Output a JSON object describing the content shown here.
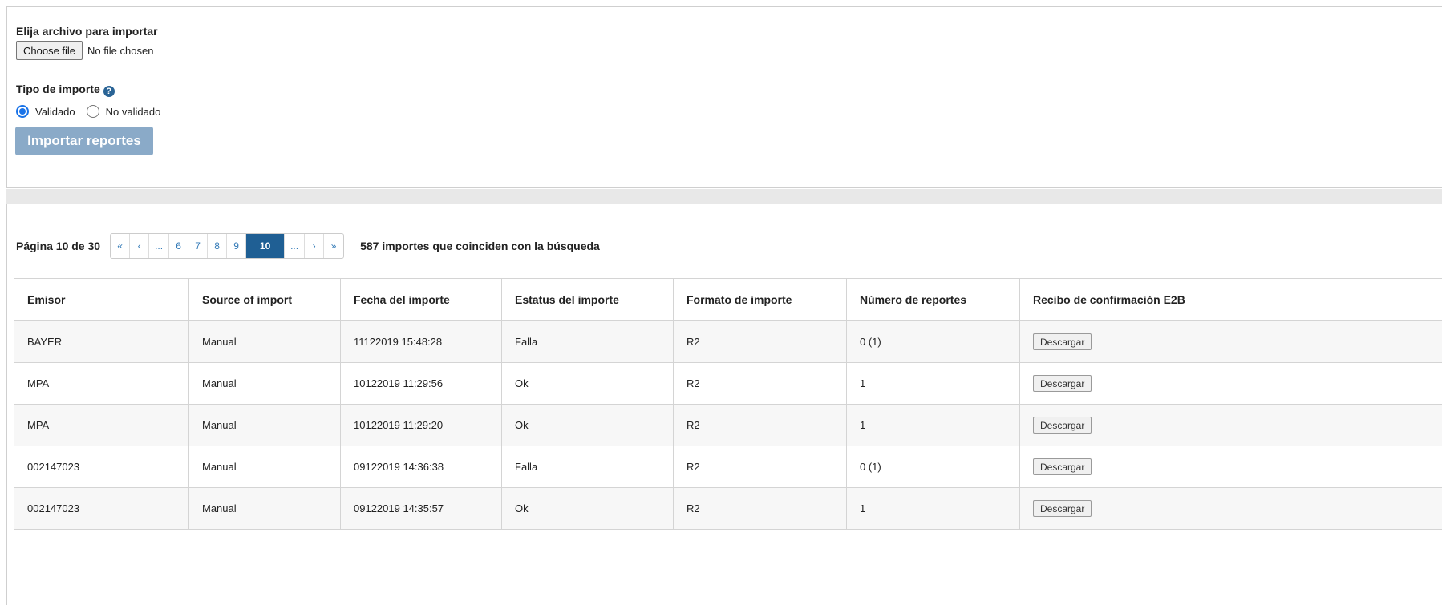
{
  "import_form": {
    "file_label": "Elija archivo para importar",
    "choose_file_label": "Choose file",
    "no_file_text": "No file chosen",
    "type_label": "Tipo de importe",
    "radio_options": [
      {
        "label": "Validado",
        "checked": true
      },
      {
        "label": "No validado",
        "checked": false
      }
    ],
    "import_button_label": "Importar reportes"
  },
  "pagination": {
    "page_info": "Página 10 de 30",
    "items": [
      "«",
      "‹",
      "...",
      "6",
      "7",
      "8",
      "9",
      "10",
      "...",
      "›",
      "»"
    ],
    "current": "10",
    "match_count": "587 importes que coinciden con la búsqueda"
  },
  "table": {
    "headers": [
      "Emisor",
      "Source of import",
      "Fecha del importe",
      "Estatus del importe",
      "Formato de importe",
      "Número de reportes",
      "Recibo de confirmación E2B"
    ],
    "download_label": "Descargar",
    "rows": [
      {
        "emisor": "BAYER",
        "source": "Manual",
        "fecha": "11122019 15:48:28",
        "estatus": "Falla",
        "formato": "R2",
        "numero": "0 (1)"
      },
      {
        "emisor": "MPA",
        "source": "Manual",
        "fecha": "10122019 11:29:56",
        "estatus": "Ok",
        "formato": "R2",
        "numero": "1"
      },
      {
        "emisor": "MPA",
        "source": "Manual",
        "fecha": "10122019 11:29:20",
        "estatus": "Ok",
        "formato": "R2",
        "numero": "1"
      },
      {
        "emisor": "002147023",
        "source": "Manual",
        "fecha": "09122019 14:36:38",
        "estatus": "Falla",
        "formato": "R2",
        "numero": "0 (1)"
      },
      {
        "emisor": "002147023",
        "source": "Manual",
        "fecha": "09122019 14:35:57",
        "estatus": "Ok",
        "formato": "R2",
        "numero": "1"
      }
    ]
  }
}
